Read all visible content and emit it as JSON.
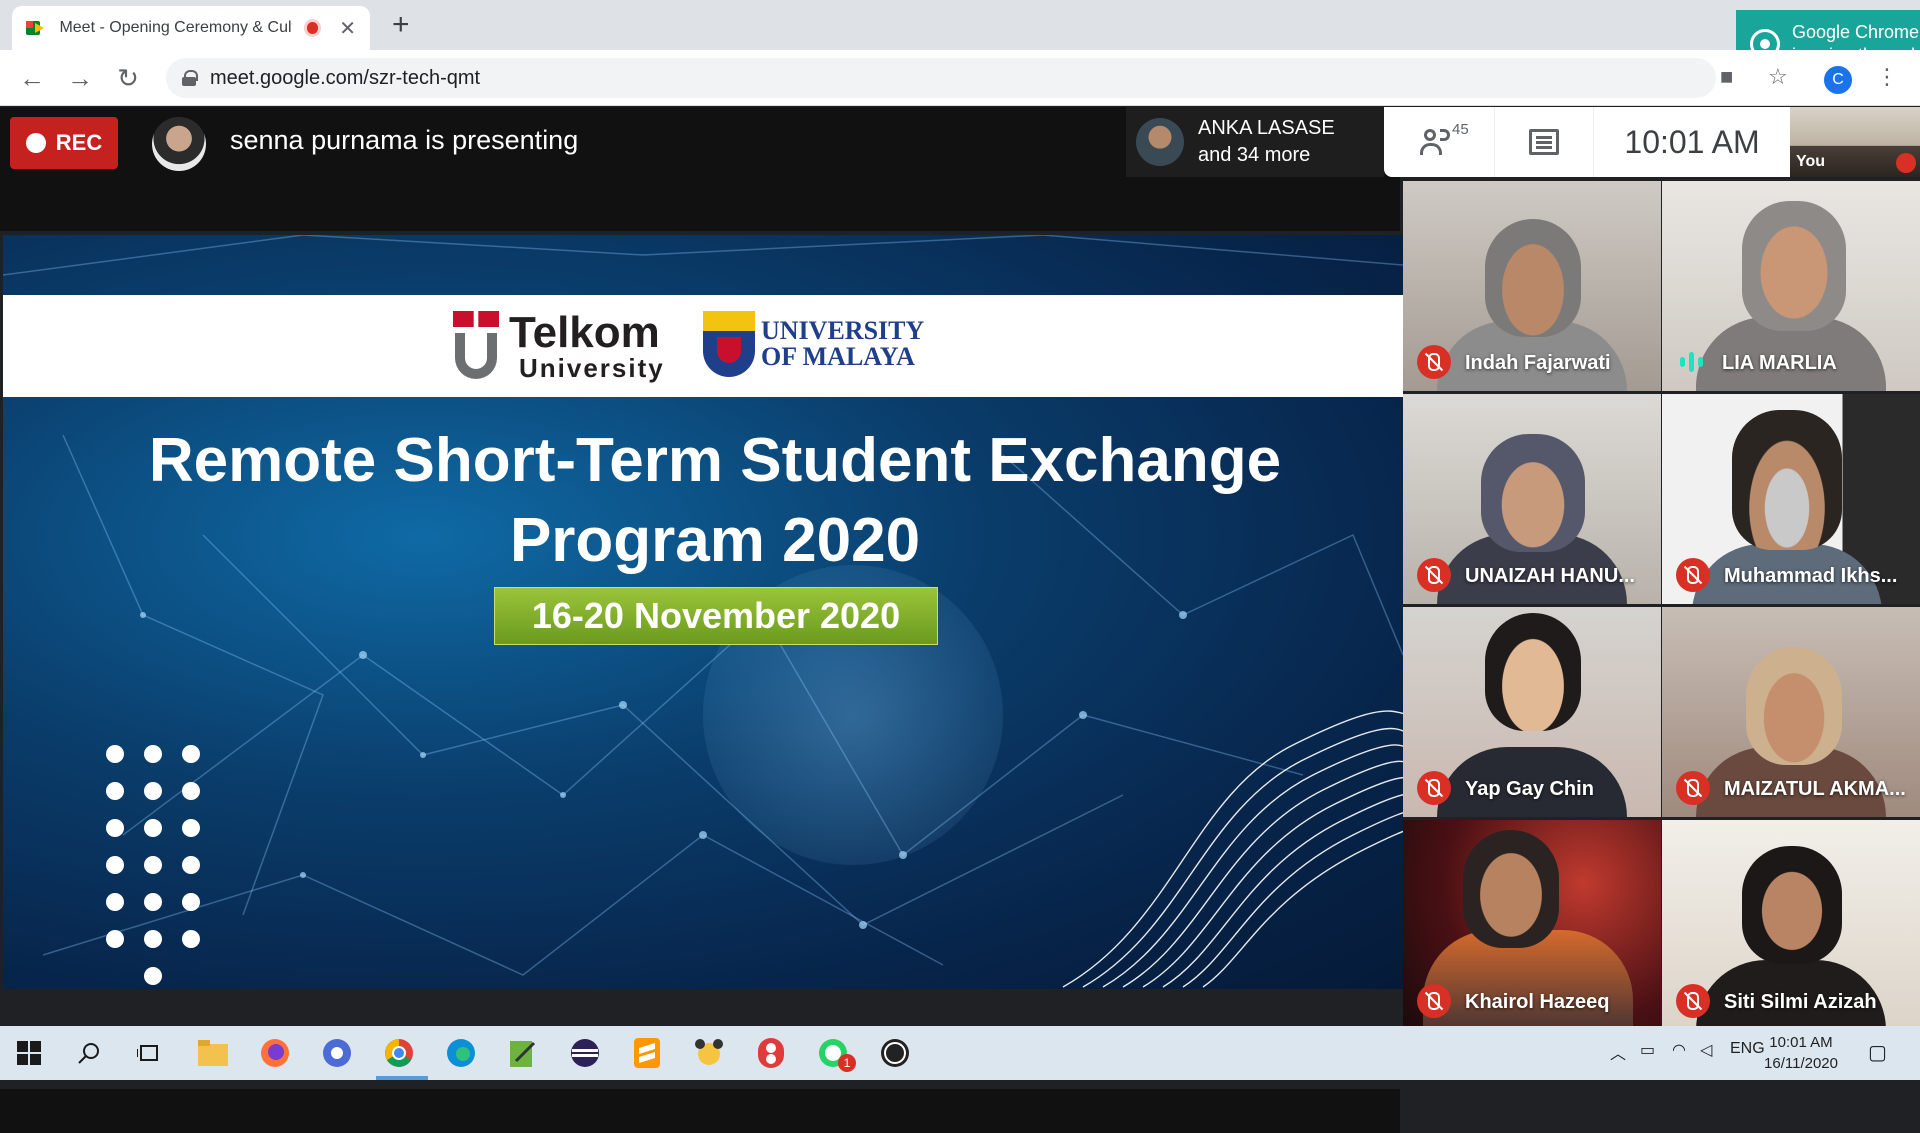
{
  "browser": {
    "tab_title": "Meet - Opening Ceremony & Cult",
    "url": "meet.google.com/szr-tech-qmt",
    "new_tab": "+",
    "close_tab": "✕",
    "profile_initial": "C",
    "notification_line1": "Google Chrome",
    "notification_line2": "is using the web"
  },
  "meet": {
    "rec_label": "REC",
    "presenting_text": "senna purnama is presenting",
    "others_line1": "ANKA LASASE",
    "others_line2": "and 34 more",
    "people_count": "45",
    "time": "10:01 AM",
    "self_label": "You"
  },
  "slide": {
    "telkom_line1": "Telkom",
    "telkom_line2": "University",
    "um_line1": "UNIVERSITY",
    "um_line2": "OF MALAYA",
    "title_line1": "Remote Short-Term Student Exchange",
    "title_line2": "Program 2020",
    "date": "16-20 November 2020"
  },
  "participants": [
    {
      "name": "Indah Fajarwati",
      "muted": true
    },
    {
      "name": "LIA MARLIA",
      "muted": false
    },
    {
      "name": "UNAIZAH HANU...",
      "muted": true
    },
    {
      "name": "Muhammad Ikhs...",
      "muted": true
    },
    {
      "name": "Yap Gay Chin",
      "muted": true
    },
    {
      "name": "MAIZATUL AKMA...",
      "muted": true
    },
    {
      "name": "Khairol Hazeeq",
      "muted": true
    },
    {
      "name": "Siti Silmi Azizah",
      "muted": true
    }
  ],
  "taskbar": {
    "language": "ENG",
    "clock_time": "10:01 AM",
    "clock_date": "16/11/2020",
    "whatsapp_badge": "1"
  },
  "colors": {
    "rec": "#c5221f",
    "muted": "#d93025",
    "speaking": "#1ee3c0",
    "date_box": "#7fb02a",
    "notification": "#1aa59a"
  }
}
